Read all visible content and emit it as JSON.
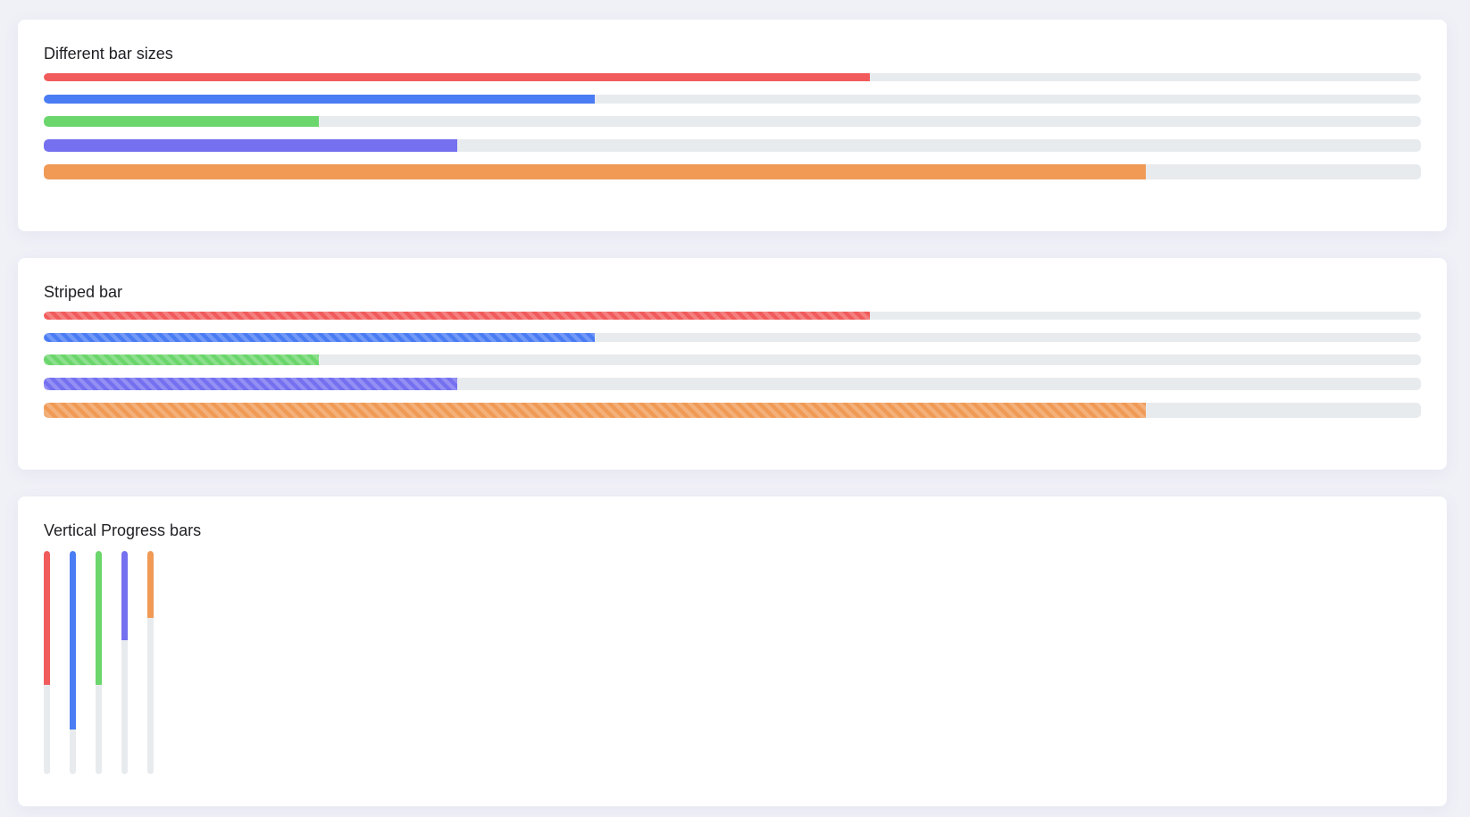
{
  "sections": [
    {
      "title": "Different bar sizes",
      "style": "solid",
      "bars": [
        {
          "color": "#f15b5b",
          "progress": 60
        },
        {
          "color": "#4a7cf3",
          "progress": 40
        },
        {
          "color": "#6bd66b",
          "progress": 20
        },
        {
          "color": "#7570f0",
          "progress": 30
        },
        {
          "color": "#f09a55",
          "progress": 80
        }
      ]
    },
    {
      "title": "Striped bar",
      "style": "striped",
      "bars": [
        {
          "color": "#f15b5b",
          "progress": 60
        },
        {
          "color": "#4a7cf3",
          "progress": 40
        },
        {
          "color": "#6bd66b",
          "progress": 20
        },
        {
          "color": "#7570f0",
          "progress": 30
        },
        {
          "color": "#f09a55",
          "progress": 80
        }
      ]
    },
    {
      "title": "Vertical Progress bars",
      "style": "vertical",
      "bars": [
        {
          "color": "#f15b5b",
          "progress": 60
        },
        {
          "color": "#4a7cf3",
          "progress": 80
        },
        {
          "color": "#6bd66b",
          "progress": 60
        },
        {
          "color": "#7570f0",
          "progress": 40
        },
        {
          "color": "#f09a55",
          "progress": 30
        }
      ]
    }
  ]
}
